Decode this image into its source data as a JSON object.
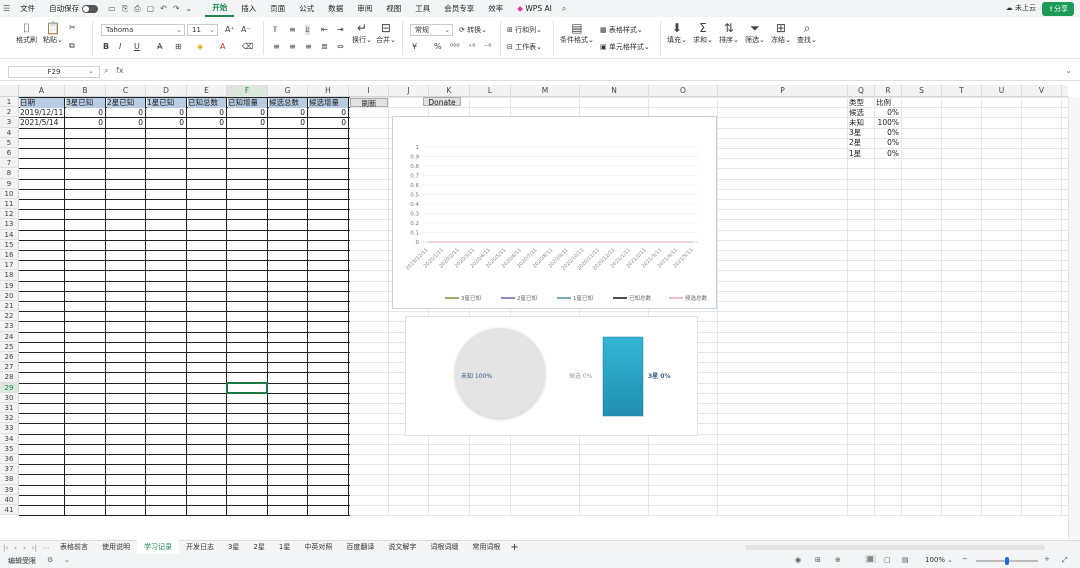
{
  "menubar": {
    "file": "文件",
    "autosave": "自动保存",
    "tabs": [
      "开始",
      "插入",
      "页面",
      "公式",
      "数据",
      "审阅",
      "视图",
      "工具",
      "会员专享",
      "效率"
    ],
    "wps_ai": "WPS AI",
    "cloud": "未上云",
    "share": "分享"
  },
  "ribbon": {
    "format_painter": "格式刷",
    "paste": "粘贴",
    "font_name": "Tahoma",
    "font_size": "11",
    "wrap": "换行",
    "merge": "合并",
    "number_format": "常规",
    "convert": "转换",
    "row_col": "行和列",
    "worksheet": "工作表",
    "cond_format": "条件格式",
    "table_style": "表格样式",
    "cell_style": "单元格样式",
    "fill": "填充",
    "sum": "求和",
    "sort": "排序",
    "filter": "筛选",
    "freeze": "冻结",
    "find": "查找"
  },
  "formula": {
    "cell_ref": "F29",
    "fx": "fx",
    "value": ""
  },
  "columns": [
    "A",
    "B",
    "C",
    "D",
    "E",
    "F",
    "G",
    "H",
    "I",
    "J",
    "K",
    "L",
    "M",
    "N",
    "O",
    "P",
    "Q",
    "R",
    "S",
    "T",
    "U",
    "V"
  ],
  "selected_col": "F",
  "selected_row": "29",
  "rows": [
    "1",
    "2",
    "3",
    "4",
    "5",
    "6",
    "7",
    "8",
    "9",
    "10",
    "11",
    "12",
    "13",
    "14",
    "15",
    "16",
    "17",
    "18",
    "19",
    "20",
    "21",
    "22",
    "23",
    "24",
    "25",
    "26",
    "27",
    "28",
    "29",
    "30",
    "31",
    "32",
    "33",
    "34",
    "35",
    "36",
    "37",
    "38",
    "39",
    "40",
    "41"
  ],
  "table": {
    "headers": [
      "日期",
      "3星已知",
      "2星已知",
      "1星已知",
      "已知总数",
      "已知增量",
      "候选总数",
      "候选增量"
    ],
    "rows": [
      [
        "2019/12/11",
        "0",
        "0",
        "0",
        "0",
        "0",
        "0",
        "0"
      ],
      [
        "2021/5/14",
        "0",
        "0",
        "0",
        "0",
        "0",
        "0",
        "0"
      ]
    ]
  },
  "buttons": {
    "refresh": "刷新",
    "donate": "Donate"
  },
  "summary": {
    "headers": [
      "类型",
      "比例"
    ],
    "rows": [
      [
        "候选",
        "0%"
      ],
      [
        "未知",
        "100%"
      ],
      [
        "3星",
        "0%"
      ],
      [
        "2星",
        "0%"
      ],
      [
        "1星",
        "0%"
      ]
    ]
  },
  "chart_data": [
    {
      "type": "line",
      "x": [
        "2019/12/11",
        "2020/1/11",
        "2020/2/11",
        "2020/3/11",
        "2020/4/11",
        "2020/5/11",
        "2020/6/11",
        "2020/7/11",
        "2020/8/11",
        "2020/9/11",
        "2020/10/11",
        "2020/11/11",
        "2020/12/11",
        "2021/1/11",
        "2021/2/11",
        "2021/3/11",
        "2021/4/11",
        "2021/5/11"
      ],
      "yticks": [
        "1",
        "0.9",
        "0.8",
        "0.7",
        "0.6",
        "0.5",
        "0.4",
        "0.3",
        "0.2",
        "0.1",
        "0"
      ],
      "ylim": [
        0,
        1
      ],
      "series": [
        {
          "name": "3星已知",
          "color": "#8a8a3a",
          "values": [
            0,
            0
          ]
        },
        {
          "name": "2星已知",
          "color": "#7a5ea8",
          "values": [
            0,
            0
          ]
        },
        {
          "name": "1星已知",
          "color": "#4a8ea8",
          "values": [
            0,
            0
          ]
        },
        {
          "name": "已知总数",
          "color": "#111111",
          "values": [
            0,
            0
          ]
        },
        {
          "name": "候选总数",
          "color": "#e8a9b6",
          "values": [
            0,
            0
          ]
        }
      ],
      "legend": "bottom",
      "grid": true
    },
    {
      "type": "pie",
      "slices": [
        {
          "label": "未知",
          "value": 100
        },
        {
          "label": "候选",
          "value": 0
        }
      ],
      "labels": [
        "未知 100%",
        "候选 0%"
      ],
      "bar_label": "3星 0%",
      "color": "#e4e4e4",
      "bar_color": "#2aa7c9"
    }
  ],
  "sheet_tabs": [
    "表格前言",
    "使用说明",
    "学习记录",
    "开发日志",
    "3星",
    "2星",
    "1星",
    "中英对照",
    "百度翻译",
    "说文解字",
    "词根词缀",
    "常用词根"
  ],
  "active_tab": "学习记录",
  "status": {
    "mode": "编辑受限",
    "zoom": "100%"
  }
}
